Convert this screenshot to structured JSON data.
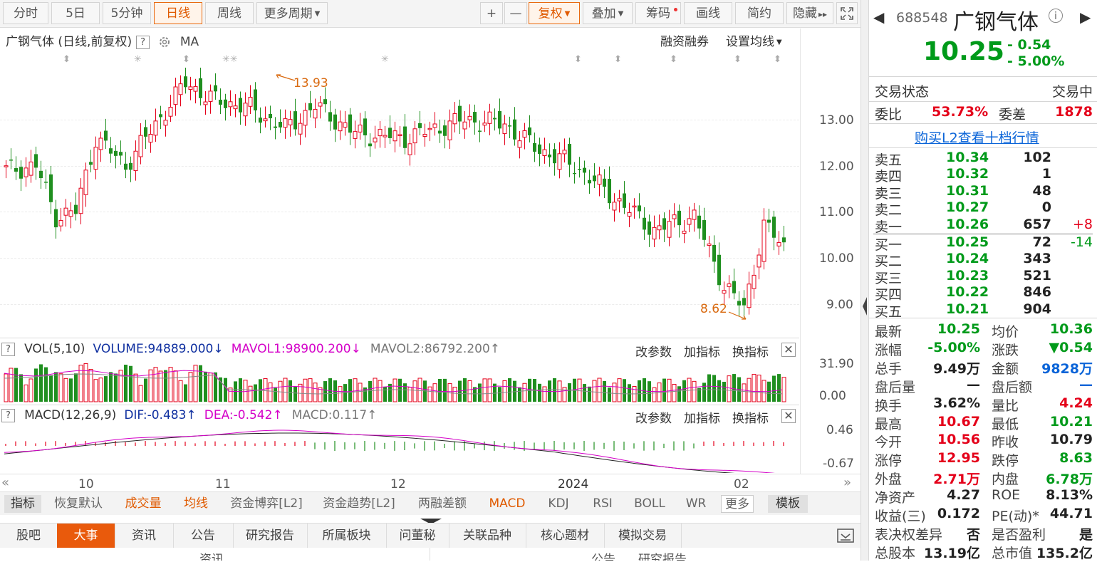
{
  "toolbar": {
    "periods": [
      "分时",
      "5日",
      "5分钟",
      "日线",
      "周线",
      "更多周期"
    ],
    "active_period": "日线",
    "plus": "+",
    "minus": "—",
    "fuquan": "复权",
    "diejia": "叠加",
    "chouma": "筹码",
    "huaxian": "画线",
    "jianyue": "简约",
    "yincang": "隐藏",
    "hide_arrows": "▸▸"
  },
  "chart": {
    "title": "广钢气体 (日线,前复权)",
    "ma_label": "MA",
    "rzrq": "融资融券",
    "set_ma": "设置均线",
    "high_label": "13.93",
    "low_label": "8.62",
    "y_ticks": [
      "13.00",
      "12.00",
      "11.00",
      "10.00",
      "9.00"
    ],
    "vol_header": {
      "name": "VOL(5,10)",
      "volume": "VOLUME:94889.000",
      "mavol1": "MAVOL1:98900.200",
      "mavol2": "MAVOL2:86792.200"
    },
    "vol_ticks": [
      "31.90",
      "0.00"
    ],
    "macd_header": {
      "name": "MACD(12,26,9)",
      "dif": "DIF:-0.483",
      "dea": "DEA:-0.542",
      "macd": "MACD:0.117"
    },
    "macd_ticks": [
      "0.46",
      "-0.67"
    ],
    "panel_buttons": [
      "改参数",
      "加指标",
      "换指标"
    ],
    "x_labels": [
      "10",
      "11",
      "12",
      "2024",
      "02"
    ],
    "colors": {
      "up": "#e4001a",
      "down": "#1f8f1f",
      "mavol1": "#d400c8",
      "dea": "#d400c8",
      "annot": "#d96a10"
    }
  },
  "indicator_bar": {
    "items": [
      "指标",
      "恢复默认",
      "成交量",
      "均线",
      "资金博弈[L2]",
      "资金趋势[L2]",
      "两融差额",
      "MACD",
      "KDJ",
      "RSI",
      "BOLL",
      "WR",
      "更多"
    ],
    "template": "模板"
  },
  "bottom_tabs": [
    "股吧",
    "大事",
    "资讯",
    "公告",
    "研究报告",
    "所属板块",
    "问董秘",
    "关联品种",
    "核心题材",
    "模拟交易"
  ],
  "bottom_subtitles": [
    "资讯",
    "公告",
    "研究报告"
  ],
  "sidebar": {
    "code": "688548",
    "name": "广钢气体",
    "price": "10.25",
    "change": "- 0.54",
    "change_pct": "- 5.00%",
    "status_label": "交易状态",
    "status_value": "交易中",
    "weibi_label": "委比",
    "weibi": "53.73%",
    "weicha_label": "委差",
    "weicha": "1878",
    "l2_link": "购买L2查看十档行情",
    "asks": [
      {
        "label": "卖五",
        "price": "10.34",
        "vol": "102",
        "chg": ""
      },
      {
        "label": "卖四",
        "price": "10.32",
        "vol": "1",
        "chg": ""
      },
      {
        "label": "卖三",
        "price": "10.31",
        "vol": "48",
        "chg": ""
      },
      {
        "label": "卖二",
        "price": "10.27",
        "vol": "0",
        "chg": ""
      },
      {
        "label": "卖一",
        "price": "10.26",
        "vol": "657",
        "chg": "+8"
      }
    ],
    "bids": [
      {
        "label": "买一",
        "price": "10.25",
        "vol": "72",
        "chg": "-14"
      },
      {
        "label": "买二",
        "price": "10.24",
        "vol": "343",
        "chg": ""
      },
      {
        "label": "买三",
        "price": "10.23",
        "vol": "521",
        "chg": ""
      },
      {
        "label": "买四",
        "price": "10.22",
        "vol": "846",
        "chg": ""
      },
      {
        "label": "买五",
        "price": "10.21",
        "vol": "904",
        "chg": ""
      }
    ],
    "stats": [
      [
        "最新",
        "10.25",
        "green",
        "均价",
        "10.36",
        "green"
      ],
      [
        "涨幅",
        "-5.00%",
        "green",
        "涨跌",
        "▼0.54",
        "green"
      ],
      [
        "总手",
        "9.49万",
        "dark",
        "金额",
        "9828万",
        "blue"
      ],
      [
        "盘后量",
        "—",
        "dark",
        "盘后额",
        "—",
        "blue"
      ],
      [
        "换手",
        "3.62%",
        "dark",
        "量比",
        "4.24",
        "red"
      ],
      [
        "最高",
        "10.67",
        "red",
        "最低",
        "10.21",
        "green"
      ],
      [
        "今开",
        "10.56",
        "red",
        "昨收",
        "10.79",
        "dark"
      ],
      [
        "涨停",
        "12.95",
        "red",
        "跌停",
        "8.63",
        "green"
      ],
      [
        "外盘",
        "2.71万",
        "red",
        "内盘",
        "6.78万",
        "green"
      ],
      [
        "净资产",
        "4.27",
        "dark",
        "ROE",
        "8.13%",
        "dark"
      ],
      [
        "收益(三)",
        "0.172",
        "dark",
        "PE(动)*",
        "44.71",
        "dark"
      ],
      [
        "表决权差异",
        "否",
        "dark",
        "是否盈利",
        "是",
        "dark"
      ],
      [
        "总股本",
        "13.19亿",
        "dark",
        "总市值",
        "135.2亿",
        "dark"
      ]
    ]
  }
}
